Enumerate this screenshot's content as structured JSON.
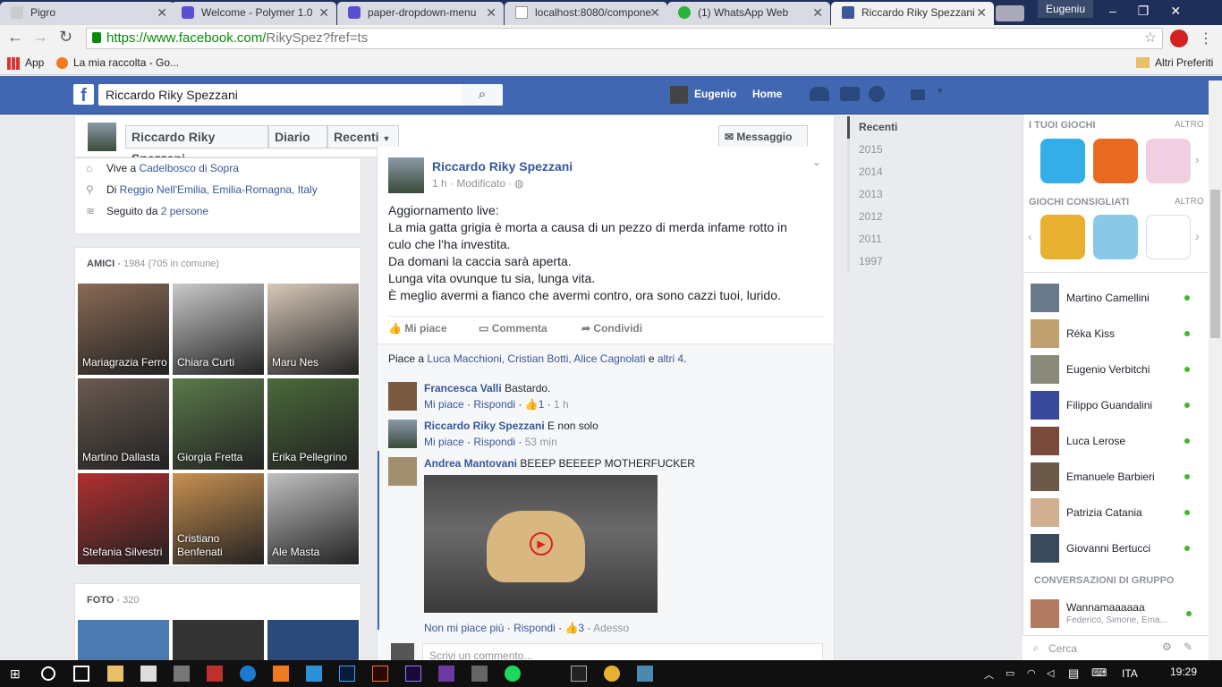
{
  "browser": {
    "tabs": [
      {
        "title": "Pigro",
        "color": "#cccccc"
      },
      {
        "title": "Welcome - Polymer 1.0",
        "color": "#5a4fcf"
      },
      {
        "title": "paper-dropdown-menu",
        "color": "#5a4fcf"
      },
      {
        "title": "localhost:8080/compone",
        "color": "#999999"
      },
      {
        "title": "(1) WhatsApp Web",
        "color": "#2ab33a"
      },
      {
        "title": "Riccardo Riky Spezzani",
        "color": "#3b5998"
      }
    ],
    "user": "Eugeniu",
    "url_host": "https://www.facebook.com/",
    "url_path": "RikySpez?fref=ts",
    "bookmarks": {
      "apps": "App",
      "raccolta": "La mia raccolta - Go...",
      "altri": "Altri Preferiti"
    }
  },
  "fb": {
    "search_value": "Riccardo Riky Spezzani",
    "user": "Eugenio",
    "home": "Home",
    "profile_name": "Riccardo Riky Spezzani",
    "diario": "Diario",
    "recenti": "Recenti",
    "messaggio": "Messaggio"
  },
  "intro": {
    "lives_prefix": "Vive a ",
    "lives": "Cadelbosco di Sopra",
    "from_prefix": "Di ",
    "from": "Reggio Nell'Emilia, Emilia-Romagna, Italy",
    "followed_prefix": "Seguito da ",
    "followed": "2 persone"
  },
  "friends": {
    "title": "AMICI",
    "count": "1984 (705 in comune)",
    "list": [
      {
        "name": "Mariagrazia Ferro",
        "color": "#8a6a55"
      },
      {
        "name": "Chiara Curti",
        "color": "#c9c9c9"
      },
      {
        "name": "Maru Nes",
        "color": "#d8c8b8"
      },
      {
        "name": "Martino Dallasta",
        "color": "#6a5a50"
      },
      {
        "name": "Giorgia Fretta",
        "color": "#5a7a4a"
      },
      {
        "name": "Erika Pellegrino",
        "color": "#4a6a3a"
      },
      {
        "name": "Stefania Silvestri",
        "color": "#b03030"
      },
      {
        "name": "Cristiano Benfenati",
        "color": "#c89050"
      },
      {
        "name": "Ale Masta",
        "color": "#c0c0c0"
      }
    ]
  },
  "photos": {
    "title": "FOTO",
    "count": "320"
  },
  "post": {
    "author": "Riccardo Riky Spezzani",
    "meta": "1 h · Modificato ·",
    "lines": [
      "Aggiornamento live:",
      "La mia gatta grigia è morta a causa di un pezzo di merda infame rotto in",
      "culo che l'ha investita.",
      "Da domani la caccia sarà aperta.",
      "Lunga vita ovunque tu sia, lunga vita.",
      "È meglio avermi a fianco che avermi contro, ora sono cazzi tuoi, lurido."
    ],
    "actions": {
      "like": "Mi piace",
      "comment": "Commenta",
      "share": "Condividi"
    },
    "likes": {
      "prefix": "Piace a ",
      "names": "Luca Macchioni, Cristian Botti, Alice Cagnolati",
      "mid": " e ",
      "others": "altri 4",
      "end": "."
    }
  },
  "comments": [
    {
      "author": "Francesca Valli",
      "text": " Bastardo.",
      "like": "Mi piace",
      "reply": "Rispondi",
      "count": "1",
      "time": "1 h",
      "color": "#7a5a40"
    },
    {
      "author": "Riccardo Riky Spezzani",
      "text": " E non solo",
      "like": "Mi piace",
      "reply": "Rispondi",
      "count": "",
      "time": "53 min",
      "color": "#5a6a70"
    },
    {
      "author": "Andrea Mantovani",
      "text": " BEEEP BEEEEP MOTHERFUCKER",
      "like": "Non mi piace più",
      "reply": "Rispondi",
      "count": "3",
      "time": "Adesso",
      "color": "#a09070"
    }
  ],
  "comment_placeholder": "Scrivi un commento...",
  "years": [
    "Recenti",
    "2015",
    "2014",
    "2013",
    "2012",
    "2011",
    "1997"
  ],
  "games": {
    "yours": "I TUOI GIOCHI",
    "recommended": "GIOCHI CONSIGLIATI",
    "more": "ALTRO"
  },
  "chat": {
    "contacts": [
      {
        "name": "Martino Camellini",
        "color": "#6a7a8a"
      },
      {
        "name": "Réka Kiss",
        "color": "#c0a070"
      },
      {
        "name": "Eugenio Verbitchi",
        "color": "#8a8a7a"
      },
      {
        "name": "Filippo Guandalini",
        "color": "#3a4a9a"
      },
      {
        "name": "Luca Lerose",
        "color": "#7a4a3a"
      },
      {
        "name": "Emanuele Barbieri",
        "color": "#6a5a4a"
      },
      {
        "name": "Patrizia Catania",
        "color": "#d0b090"
      },
      {
        "name": "Giovanni Bertucci",
        "color": "#3a4a5a"
      }
    ],
    "group_title": "CONVERSAZIONI DI GRUPPO",
    "group_name": "Wannamaaaaaa",
    "group_members": "Federico, Simone, Ema...",
    "search_placeholder": "Cerca"
  },
  "taskbar": {
    "lang": "ITA",
    "time": "19:29"
  }
}
